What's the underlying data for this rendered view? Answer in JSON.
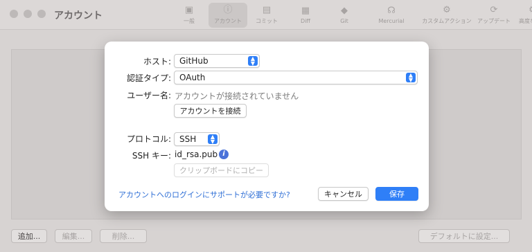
{
  "window": {
    "title": "アカウント",
    "toolbar": [
      {
        "label": "一般",
        "icon": "general-icon",
        "glyph": "▣"
      },
      {
        "label": "アカウント",
        "icon": "account-icon",
        "glyph": "ⓘ",
        "active": true
      },
      {
        "label": "コミット",
        "icon": "commit-icon",
        "glyph": "▤"
      },
      {
        "label": "Diff",
        "icon": "diff-icon",
        "glyph": "▦"
      },
      {
        "label": "Git",
        "icon": "git-icon",
        "glyph": "◆"
      },
      {
        "label": "Mercurial",
        "icon": "mercurial-icon",
        "glyph": "☊"
      },
      {
        "label": "カスタムアクション",
        "icon": "custom-action-icon",
        "glyph": "⚙"
      },
      {
        "label": "アップデート",
        "icon": "update-icon",
        "glyph": "⟳"
      },
      {
        "label": "高度な設定",
        "icon": "advanced-icon",
        "glyph": "⚙"
      }
    ]
  },
  "bottom": {
    "add": "追加...",
    "edit": "編集...",
    "delete": "削除...",
    "set_default": "デフォルトに設定..."
  },
  "dialog": {
    "host_label": "ホスト:",
    "host_value": "GitHub",
    "auth_label": "認証タイプ:",
    "auth_value": "OAuth",
    "username_label": "ユーザー名:",
    "username_value": "アカウントが接続されていません",
    "connect_button": "アカウントを接続",
    "protocol_label": "プロトコル:",
    "protocol_value": "SSH",
    "ssh_key_label": "SSH キー:",
    "ssh_key_value": "id_rsa.pub",
    "info_glyph": "i",
    "copy_button": "クリップボードにコピー",
    "help_link": "アカウントへのログインにサポートが必要ですか?",
    "cancel_button": "キャンセル",
    "save_button": "保存"
  },
  "colors": {
    "accent": "#2f7ff7",
    "link": "#2f6fd6"
  }
}
